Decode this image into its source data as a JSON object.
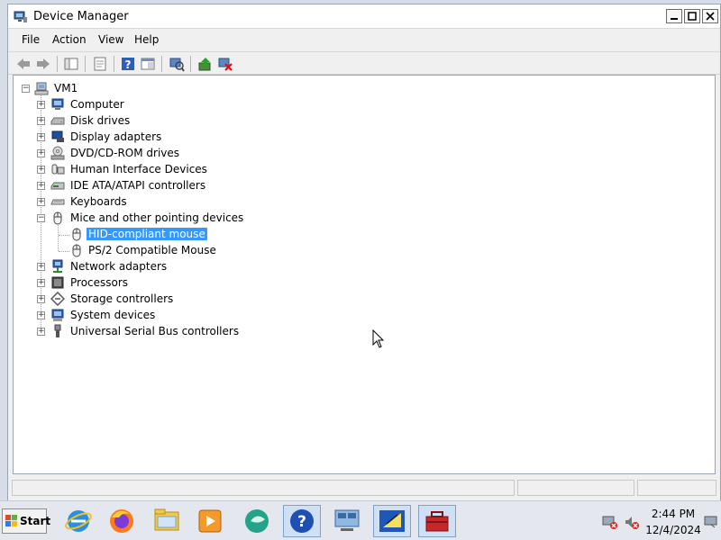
{
  "window": {
    "title": "Device Manager"
  },
  "menubar": {
    "items": [
      "File",
      "Action",
      "View",
      "Help"
    ]
  },
  "tree": {
    "root": "VM1",
    "categories": [
      "Computer",
      "Disk drives",
      "Display adapters",
      "DVD/CD-ROM drives",
      "Human Interface Devices",
      "IDE ATA/ATAPI controllers",
      "Keyboards",
      "Mice and other pointing devices",
      "Network adapters",
      "Processors",
      "Storage controllers",
      "System devices",
      "Universal Serial Bus controllers"
    ],
    "expanded_category": "Mice and other pointing devices",
    "mice_children": [
      "HID-compliant mouse",
      "PS/2 Compatible Mouse"
    ],
    "selected": "HID-compliant mouse"
  },
  "taskbar": {
    "start_label": "Start",
    "time": "2:44 PM",
    "date": "12/4/2024",
    "apps": [
      "internet-explorer",
      "firefox",
      "file-explorer",
      "media-player",
      "messenger",
      "help",
      "network",
      "sticky-notes",
      "device-manager"
    ]
  },
  "colors": {
    "selection": "#3399ff",
    "window_bg": "#f0f0f0",
    "tree_bg": "#ffffff"
  }
}
